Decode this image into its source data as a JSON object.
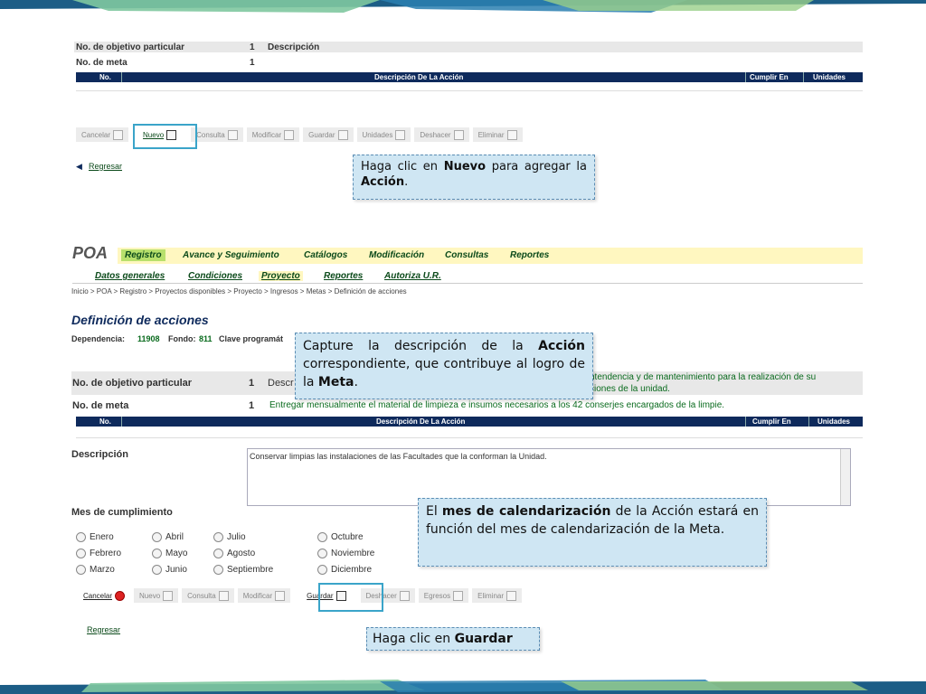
{
  "top": {
    "objetivo_label": "No. de objetivo particular",
    "objetivo_value": "1",
    "objetivo_desc": "Descripción",
    "meta_label": "No. de meta",
    "meta_value": "1",
    "table_cols": [
      "No.",
      "Descripción De La Acción",
      "Cumplir En",
      "Unidades"
    ],
    "toolbar": [
      "Cancelar",
      "Nuevo",
      "Consulta",
      "Modificar",
      "Guardar",
      "Unidades",
      "Deshacer",
      "Eliminar"
    ],
    "regresar": "Regresar"
  },
  "callout1": {
    "pre": "Haga clic en ",
    "b1": "Nuevo",
    "mid": " para agregar la ",
    "b2": "Acción",
    "post": "."
  },
  "poa": {
    "logo": "POA",
    "menu": [
      "Registro",
      "Avance y Seguimiento",
      "Catálogos",
      "Modificación",
      "Consultas",
      "Reportes"
    ],
    "submenu": [
      "Datos generales",
      "Condiciones",
      "Proyecto",
      "Reportes",
      "Autoriza U.R."
    ],
    "breadcrumb": "Inicio > POA > Registro > Proyectos disponibles > Proyecto > Ingresos > Metas > Definición de acciones",
    "title": "Definición de acciones",
    "dependencia": "Dependencia:",
    "dependencia_value": "11908",
    "fondo": "Fondo:",
    "fondo_value": "811",
    "clave": "Clave programát",
    "objetivo_label": "No. de objetivo particular",
    "objetivo_value": "1",
    "objetivo_desc_prefix": "Descr",
    "objetivo_text1": "ntendencia y de mantenimiento para la realización de su",
    "objetivo_text2": "ciones de la unidad.",
    "meta_label": "No. de meta",
    "meta_value": "1",
    "meta_text": "Entregar mensualmente el material de limpieza e insumos necesarios a los 42 conserjes encargados de la limpie.",
    "table_cols": [
      "No.",
      "Descripción De La Acción",
      "Cumplir En",
      "Unidades"
    ],
    "descripcion_label": "Descripción",
    "descripcion_value": "Conservar limpias las instalaciones de las Facultades que la conforman la Unidad.",
    "mes_label": "Mes de cumplimiento",
    "months": [
      "Enero",
      "Febrero",
      "Marzo",
      "Abril",
      "Mayo",
      "Junio",
      "Julio",
      "Agosto",
      "Septiembre",
      "Octubre",
      "Noviembre",
      "Diciembre"
    ],
    "toolbar": [
      "Cancelar",
      "Nuevo",
      "Consulta",
      "Modificar",
      "Guardar",
      "Deshacer",
      "Egresos",
      "Eliminar"
    ],
    "regresar": "Regresar"
  },
  "callout2": {
    "p1": "Capture la descripción de la ",
    "b1": "Acción",
    "p2": " correspondiente, que contribuye al logro de la ",
    "b2": "Meta",
    "p3": "."
  },
  "callout3": {
    "p1": "El ",
    "b1": "mes de calendarización",
    "p2": " de la Acción estará en función del mes de calendarización de la Meta."
  },
  "callout4": {
    "p1": "Haga clic en ",
    "b1": "Guardar"
  },
  "colors": {
    "navy": "#0e2a5c",
    "green": "#0a6b1e",
    "callout_bg": "#cfe6f3",
    "menu_bg": "#fff7c0"
  }
}
